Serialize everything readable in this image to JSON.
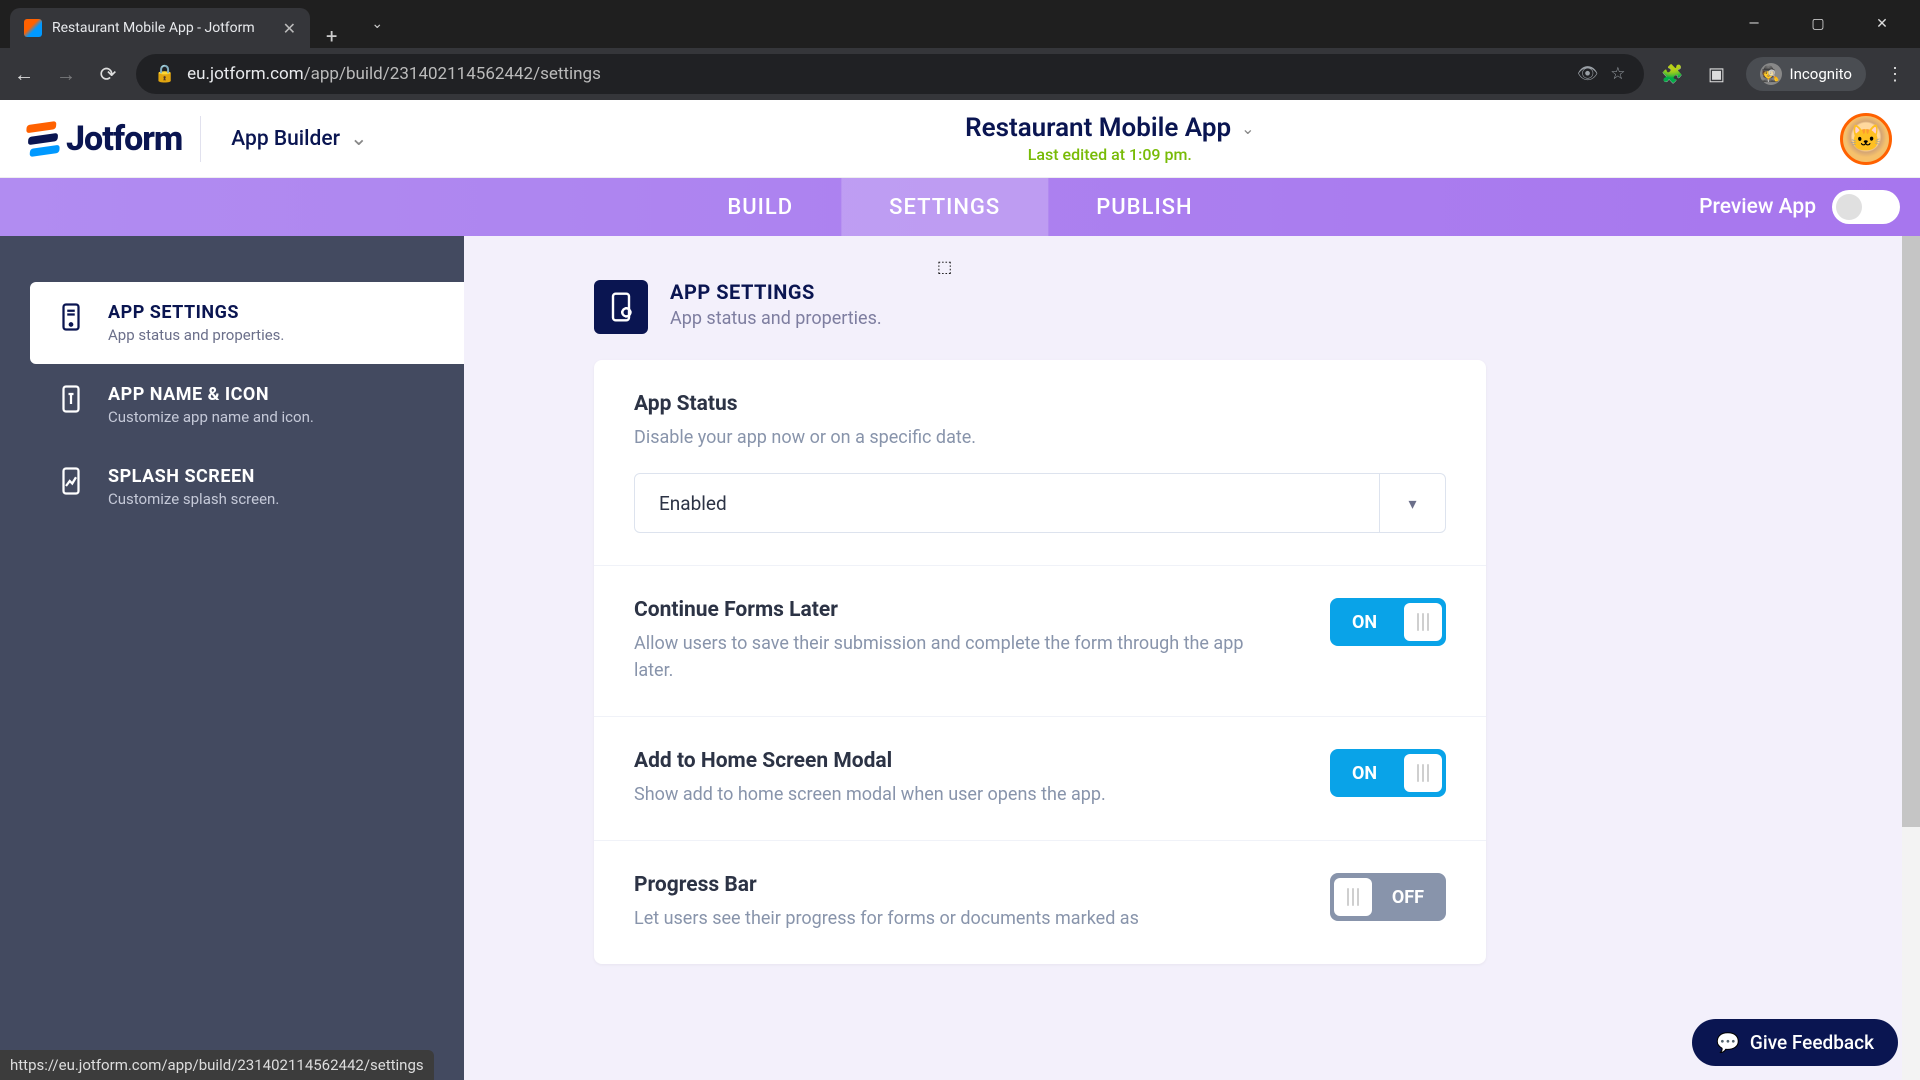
{
  "browser": {
    "tab_title": "Restaurant Mobile App - Jotform",
    "url_domain": "eu.jotform.com",
    "url_path": "/app/build/231402114562442/settings",
    "incognito_label": "Incognito"
  },
  "header": {
    "logo_text": "Jotform",
    "builder_label": "App Builder",
    "app_title": "Restaurant Mobile App",
    "last_edited": "Last edited at 1:09 pm."
  },
  "nav": {
    "tabs": [
      {
        "label": "BUILD"
      },
      {
        "label": "SETTINGS"
      },
      {
        "label": "PUBLISH"
      }
    ],
    "preview_label": "Preview App"
  },
  "sidebar": {
    "items": [
      {
        "title": "APP SETTINGS",
        "sub": "App status and properties."
      },
      {
        "title": "APP NAME & ICON",
        "sub": "Customize app name and icon."
      },
      {
        "title": "SPLASH SCREEN",
        "sub": "Customize splash screen."
      }
    ]
  },
  "main": {
    "heading": "APP SETTINGS",
    "subheading": "App status and properties.",
    "sections": {
      "status": {
        "title": "App Status",
        "desc": "Disable your app now or on a specific date.",
        "value": "Enabled"
      },
      "continue": {
        "title": "Continue Forms Later",
        "desc": "Allow users to save their submission and complete the form through the app later.",
        "switch": "ON"
      },
      "homescreen": {
        "title": "Add to Home Screen Modal",
        "desc": "Show add to home screen modal when user opens the app.",
        "switch": "ON"
      },
      "progress": {
        "title": "Progress Bar",
        "desc": "Let users see their progress for forms or documents marked as",
        "switch": "OFF"
      }
    }
  },
  "status_url": "https://eu.jotform.com/app/build/231402114562442/settings",
  "feedback_label": "Give Feedback"
}
